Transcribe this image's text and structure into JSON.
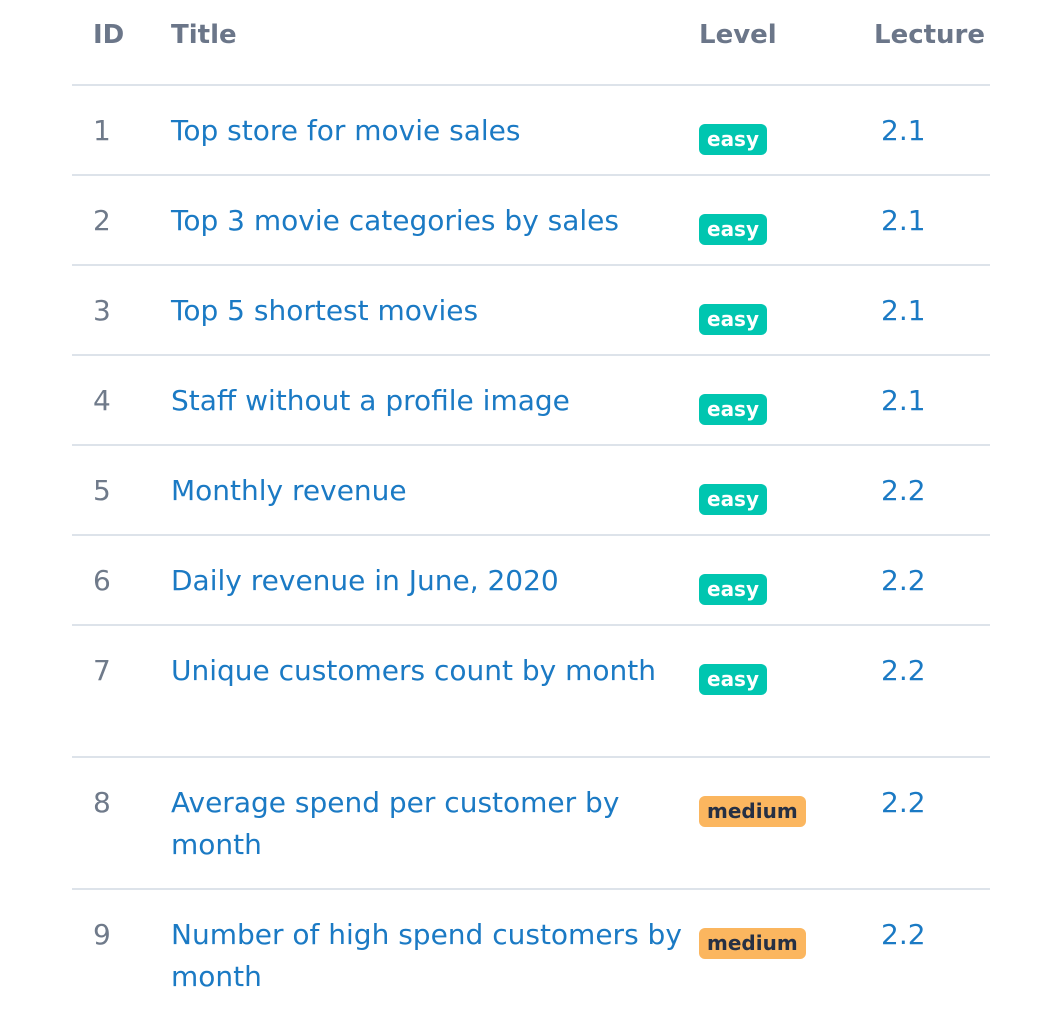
{
  "header": {
    "id": "ID",
    "title": "Title",
    "level": "Level",
    "lecture": "Lecture"
  },
  "colors": {
    "link": "#1b7ac4",
    "header_text": "#6b7689",
    "easy_badge": "#00c6b0",
    "medium_badge": "#fbb65f"
  },
  "rows": [
    {
      "id": "1",
      "title": "Top store for movie sales",
      "level": "easy",
      "lecture": "2.1"
    },
    {
      "id": "2",
      "title": "Top 3 movie categories by sales",
      "level": "easy",
      "lecture": "2.1"
    },
    {
      "id": "3",
      "title": "Top 5 shortest movies",
      "level": "easy",
      "lecture": "2.1"
    },
    {
      "id": "4",
      "title": "Staff without a profile image",
      "level": "easy",
      "lecture": "2.1"
    },
    {
      "id": "5",
      "title": "Monthly revenue",
      "level": "easy",
      "lecture": "2.2"
    },
    {
      "id": "6",
      "title": "Daily revenue in June, 2020",
      "level": "easy",
      "lecture": "2.2"
    },
    {
      "id": "7",
      "title": "Unique customers count by month",
      "level": "easy",
      "lecture": "2.2"
    },
    {
      "id": "8",
      "title": "Average spend per customer by month",
      "level": "medium",
      "lecture": "2.2"
    },
    {
      "id": "9",
      "title": "Number of high spend customers by month",
      "level": "medium",
      "lecture": "2.2"
    }
  ]
}
